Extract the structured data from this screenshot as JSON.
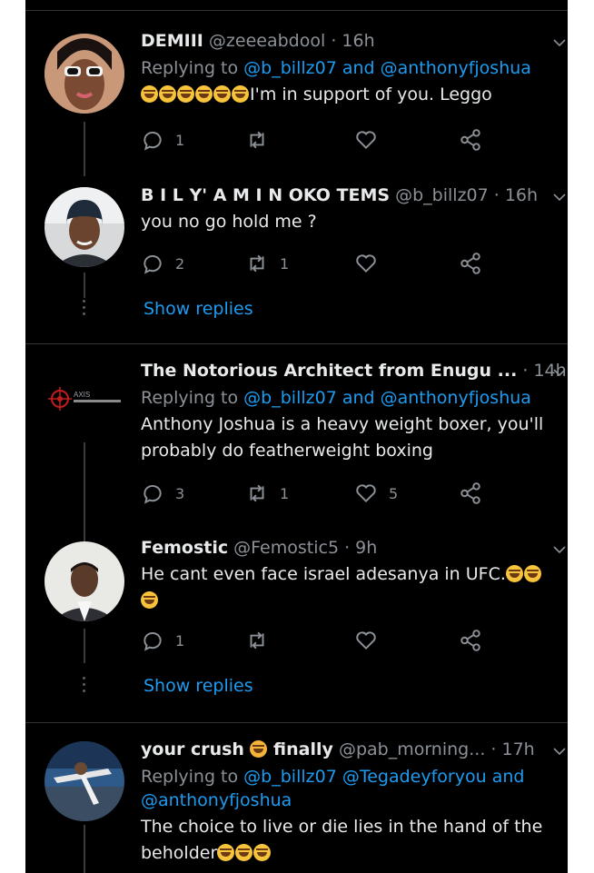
{
  "colors": {
    "background": "#000000",
    "text": "#e7e9ea",
    "muted": "#8b9197",
    "accent": "#1d9bf0",
    "divider": "#2f3336"
  },
  "tweets": [
    {
      "name": "DEMIII",
      "handle": "@zeeeabdool",
      "time": "· 16h",
      "replying_to": [
        "@b_billz07",
        "@anthonyfjoshua"
      ],
      "text": "I'm in support of you. Leggo",
      "leading_emoji_count": 6,
      "emoji": "rolling-on-floor-laughing",
      "replies": "1",
      "retweets": "",
      "likes": ""
    },
    {
      "name": "B I L Y' A M I N OKO TEMS",
      "handle": "@b_billz07",
      "time": "· 16h",
      "text": "you no go hold me ?",
      "replies": "2",
      "retweets": "1",
      "likes": ""
    },
    {
      "name": "The Notorious Architect from Enugu ...",
      "handle": "",
      "time": "· 14h",
      "replying_to": [
        "@b_billz07",
        "@anthonyfjoshua"
      ],
      "text_line1": "Anthony Joshua is a heavy weight boxer, you'll",
      "text_line2": "probably do featherweight boxing",
      "replies": "3",
      "retweets": "1",
      "likes": "5"
    },
    {
      "name": "Femostic",
      "handle": "@Femostic5",
      "time": "· 9h",
      "text": "He cant even face israel adesanya in UFC.",
      "trailing_emoji": "face-with-tears-of-joy",
      "replies": "1",
      "retweets": "",
      "likes": ""
    },
    {
      "name": "your crush",
      "name_emoji": "kissing-face",
      "name_suffix": "finally",
      "handle": "@pab_morning...",
      "time": "· 17h",
      "replying_prefix": "Replying to",
      "replying_to": [
        "@b_billz07",
        "@Tegadeyforyou",
        "@anthonyfjoshua"
      ],
      "text_line1": "The choice to live or die lies in the hand of the",
      "text_line2": "beholder"
    }
  ],
  "labels": {
    "replying_to": "Replying to",
    "and": "and",
    "show_replies": "Show replies"
  },
  "avatar3_logo_text": "AXIS"
}
